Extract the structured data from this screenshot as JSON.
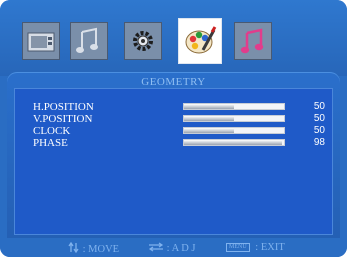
{
  "tabs": [
    {
      "icon": "picture-icon",
      "active": false
    },
    {
      "icon": "audio-notes-icon",
      "active": false
    },
    {
      "icon": "gear-icon",
      "active": false
    },
    {
      "icon": "geometry-palette-icon",
      "active": true
    },
    {
      "icon": "music-notes-icon",
      "active": false
    }
  ],
  "panel": {
    "title": "GEOMETRY"
  },
  "settings": [
    {
      "label": "H.POSITION",
      "value": "50",
      "level": 0.5
    },
    {
      "label": "V.POSITION",
      "value": "50",
      "level": 0.5
    },
    {
      "label": "CLOCK",
      "value": "50",
      "level": 0.5
    },
    {
      "label": "PHASE",
      "value": "98",
      "level": 0.98
    }
  ],
  "footer": {
    "move": ": MOVE",
    "adj": ": A D J",
    "menu_key": "MENU",
    "exit": ": EXIT"
  },
  "colors": {
    "background": "#2a6dc3",
    "content": "#1f5ac8",
    "label": "#ffffff",
    "footer_text": "#7fb2ee"
  }
}
